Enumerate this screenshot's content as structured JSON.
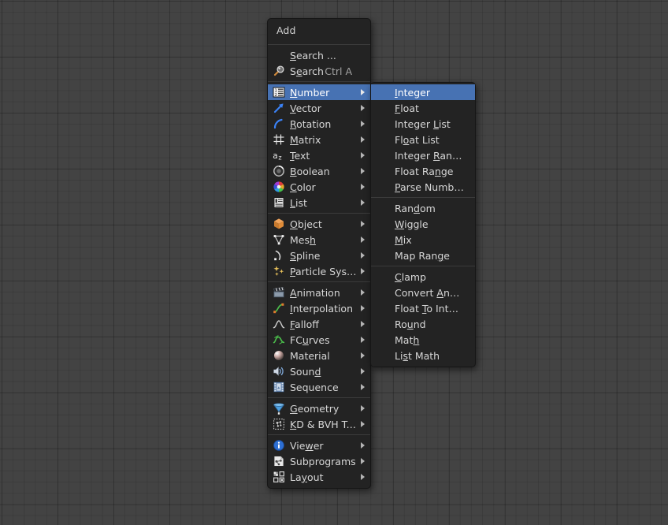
{
  "window": {
    "background_color": "#434343",
    "grid_color": "#3a3a3a"
  },
  "theme": {
    "menu_bg": "#232323",
    "menu_border": "#161616",
    "highlight": "#4772b3",
    "text": "#d6d6d6",
    "shortcut_text": "#a3a3a3",
    "separator": "#3b3b3b"
  },
  "add_menu": {
    "title": "Add",
    "search_entries": [
      {
        "label": "Search ...",
        "accel": "S",
        "icon": "none",
        "shortcut": "",
        "has_submenu": false,
        "selected": false
      },
      {
        "label": "Search",
        "accel": "e",
        "icon": "magnifier-icon",
        "shortcut": "Ctrl A",
        "has_submenu": false,
        "selected": false
      }
    ],
    "groups": [
      {
        "items": [
          {
            "label": "Number",
            "accel": "N",
            "icon": "number-list-icon",
            "has_submenu": true,
            "selected": true
          },
          {
            "label": "Vector",
            "accel": "V",
            "icon": "vector-arrow-icon",
            "has_submenu": true,
            "selected": false
          },
          {
            "label": "Rotation",
            "accel": "R",
            "icon": "rotation-arc-icon",
            "has_submenu": true,
            "selected": false
          },
          {
            "label": "Matrix",
            "accel": "M",
            "icon": "matrix-grid-icon",
            "has_submenu": true,
            "selected": false
          },
          {
            "label": "Text",
            "accel": "T",
            "icon": "text-az-icon",
            "has_submenu": true,
            "selected": false
          },
          {
            "label": "Boolean",
            "accel": "B",
            "icon": "boolean-ring-icon",
            "has_submenu": true,
            "selected": false
          },
          {
            "label": "Color",
            "accel": "C",
            "icon": "color-wheel-icon",
            "has_submenu": true,
            "selected": false
          },
          {
            "label": "List",
            "accel": "L",
            "icon": "list-lines-icon",
            "has_submenu": true,
            "selected": false
          }
        ]
      },
      {
        "items": [
          {
            "label": "Object",
            "accel": "O",
            "icon": "object-cube-icon",
            "has_submenu": true,
            "selected": false
          },
          {
            "label": "Mesh",
            "accel": "h",
            "icon": "mesh-triangle-icon",
            "has_submenu": true,
            "selected": false
          },
          {
            "label": "Spline",
            "accel": "S",
            "icon": "spline-curve-icon",
            "has_submenu": true,
            "selected": false
          },
          {
            "label": "Particle System",
            "accel": "P",
            "icon": "particles-icon",
            "has_submenu": true,
            "selected": false
          }
        ]
      },
      {
        "items": [
          {
            "label": "Animation",
            "accel": "A",
            "icon": "clapper-icon",
            "has_submenu": true,
            "selected": false
          },
          {
            "label": "Interpolation",
            "accel": "I",
            "icon": "interpolation-curve-icon",
            "has_submenu": true,
            "selected": false
          },
          {
            "label": "Falloff",
            "accel": "F",
            "icon": "falloff-bell-icon",
            "has_submenu": true,
            "selected": false
          },
          {
            "label": "FCurves",
            "accel": "u",
            "icon": "fcurve-icon",
            "has_submenu": true,
            "selected": false
          },
          {
            "label": "Material",
            "accel": "",
            "icon": "material-sphere-icon",
            "has_submenu": true,
            "selected": false
          },
          {
            "label": "Sound",
            "accel": "d",
            "icon": "speaker-icon",
            "has_submenu": true,
            "selected": false
          },
          {
            "label": "Sequence",
            "accel": "",
            "icon": "film-strip-icon",
            "has_submenu": true,
            "selected": false
          }
        ]
      },
      {
        "items": [
          {
            "label": "Geometry",
            "accel": "G",
            "icon": "geometry-cone-icon",
            "has_submenu": true,
            "selected": false
          },
          {
            "label": "KD & BVH Tree",
            "accel": "K",
            "icon": "kdtree-icon",
            "has_submenu": true,
            "selected": false
          }
        ]
      },
      {
        "items": [
          {
            "label": "Viewer",
            "accel": "w",
            "icon": "info-circle-icon",
            "has_submenu": true,
            "selected": false
          },
          {
            "label": "Subprograms",
            "accel": "",
            "icon": "subprogram-icon",
            "has_submenu": true,
            "selected": false
          },
          {
            "label": "Layout",
            "accel": "y",
            "icon": "layout-grid-icon",
            "has_submenu": true,
            "selected": false
          }
        ]
      }
    ]
  },
  "number_submenu": {
    "parent": "Number",
    "groups": [
      {
        "items": [
          {
            "label": "Integer",
            "accel": "I",
            "selected": true
          },
          {
            "label": "Float",
            "accel": "F",
            "selected": false
          },
          {
            "label": "Integer List",
            "accel": "L",
            "selected": false
          },
          {
            "label": "Float List",
            "accel": "o",
            "selected": false
          },
          {
            "label": "Integer Range",
            "accel": "R",
            "selected": false
          },
          {
            "label": "Float Range",
            "accel": "n",
            "selected": false
          },
          {
            "label": "Parse Number",
            "accel": "P",
            "selected": false
          }
        ]
      },
      {
        "items": [
          {
            "label": "Random",
            "accel": "d",
            "selected": false
          },
          {
            "label": "Wiggle",
            "accel": "W",
            "selected": false
          },
          {
            "label": "Mix",
            "accel": "M",
            "selected": false
          },
          {
            "label": "Map Range",
            "accel": "g",
            "selected": false
          }
        ]
      },
      {
        "items": [
          {
            "label": "Clamp",
            "accel": "C",
            "selected": false
          },
          {
            "label": "Convert Angle",
            "accel": "A",
            "selected": false
          },
          {
            "label": "Float To Integer",
            "accel": "T",
            "selected": false
          },
          {
            "label": "Round",
            "accel": "u",
            "selected": false
          },
          {
            "label": "Math",
            "accel": "h",
            "selected": false
          },
          {
            "label": "List Math",
            "accel": "s",
            "selected": false
          }
        ]
      }
    ]
  }
}
